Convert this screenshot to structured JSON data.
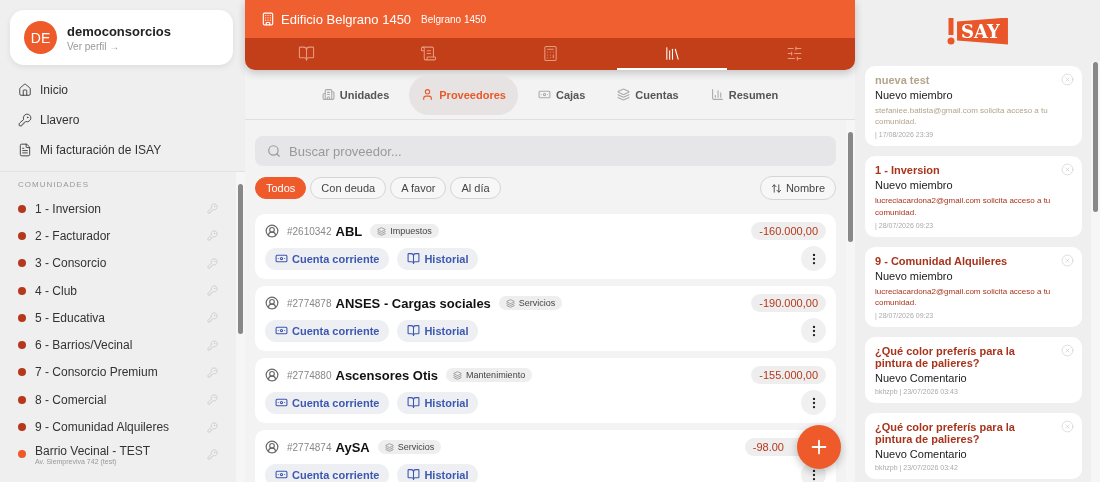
{
  "profile": {
    "initials": "DE",
    "name": "democonsorcios",
    "link": "Ver perfil →"
  },
  "nav": [
    {
      "label": "Inicio"
    },
    {
      "label": "Llavero"
    },
    {
      "label": "Mi facturación de ISAY"
    }
  ],
  "communities": {
    "heading": "COMUNIDADES",
    "items": [
      {
        "name": "1 - Inversion",
        "color": "#b5381c"
      },
      {
        "name": "2 - Facturador",
        "color": "#b5381c"
      },
      {
        "name": "3 - Consorcio",
        "color": "#b5381c"
      },
      {
        "name": "4 - Club",
        "color": "#b5381c"
      },
      {
        "name": "5 - Educativa",
        "color": "#b5381c"
      },
      {
        "name": "6 - Barrios/Vecinal",
        "color": "#b5381c"
      },
      {
        "name": "7 - Consorcio Premium",
        "color": "#b5381c"
      },
      {
        "name": "8 - Comercial",
        "color": "#b5381c"
      },
      {
        "name": "9 - Comunidad Alquileres",
        "color": "#b5381c"
      },
      {
        "name": "Barrio Vecinal - TEST",
        "address": "Av. Siempreviva 742 (test)",
        "color": "#ee5a2a"
      }
    ]
  },
  "header": {
    "title": "Edificio Belgrano 1450",
    "subtitle": "Belgrano 1450"
  },
  "section_tabs": [
    {
      "selected": false
    },
    {
      "selected": false
    },
    {
      "selected": false
    },
    {
      "selected": true
    },
    {
      "selected": false
    }
  ],
  "sub_tabs": [
    {
      "label": "Unidades",
      "selected": false
    },
    {
      "label": "Proveedores",
      "selected": true
    },
    {
      "label": "Cajas",
      "selected": false
    },
    {
      "label": "Cuentas",
      "selected": false
    },
    {
      "label": "Resumen",
      "selected": false
    }
  ],
  "search": {
    "placeholder": "Buscar proveedor..."
  },
  "filters": [
    {
      "label": "Todos",
      "selected": true
    },
    {
      "label": "Con deuda",
      "selected": false
    },
    {
      "label": "A favor",
      "selected": false
    },
    {
      "label": "Al día",
      "selected": false
    }
  ],
  "sort": {
    "label": "Nombre"
  },
  "providers": [
    {
      "id": "#2610342",
      "name": "ABL",
      "category": "Impuestos",
      "amount": "-160.000,00",
      "actions": [
        "Cuenta corriente",
        "Historial"
      ]
    },
    {
      "id": "#2774878",
      "name": "ANSES - Cargas sociales",
      "category": "Servicios",
      "amount": "-190.000,00",
      "actions": [
        "Cuenta corriente",
        "Historial"
      ]
    },
    {
      "id": "#2774880",
      "name": "Ascensores Otis",
      "category": "Mantenimiento",
      "amount": "-155.000,00",
      "actions": [
        "Cuenta corriente",
        "Historial"
      ]
    },
    {
      "id": "#2774874",
      "name": "AySA",
      "category": "Servicios",
      "amount": "-98.00",
      "actions": [
        "Cuenta corriente",
        "Historial"
      ]
    }
  ],
  "logo": {
    "text": "SAY"
  },
  "notifications": [
    {
      "title": "nueva test",
      "subtitle": "Nuevo miembro",
      "message": "stefaniee.batista@gmail.com solicita acceso a tu comunidad.",
      "meta": "| 17/08/2026 23:39",
      "color": "#b3a48c"
    },
    {
      "title": "1 - Inversion",
      "subtitle": "Nuevo miembro",
      "message": "lucreciacardona2@gmail.com solicita acceso a tu comunidad.",
      "meta": "| 28/07/2026 09:23",
      "color": "#a8341c"
    },
    {
      "title": "9 - Comunidad Alquileres",
      "subtitle": "Nuevo miembro",
      "message": "lucreciacardona2@gmail.com solicita acceso a tu comunidad.",
      "meta": "| 28/07/2026 09:23",
      "color": "#a8341c"
    },
    {
      "title": "¿Qué color preferís para la pintura de palieres?",
      "subtitle": "Nuevo Comentario",
      "meta": "bkhzpb | 23/07/2026 03:43",
      "color": "#a8341c"
    },
    {
      "title": "¿Qué color preferís para la pintura de palieres?",
      "subtitle": "Nuevo Comentario",
      "meta": "bkhzpb | 23/07/2026 03:42",
      "color": "#a8341c"
    }
  ]
}
